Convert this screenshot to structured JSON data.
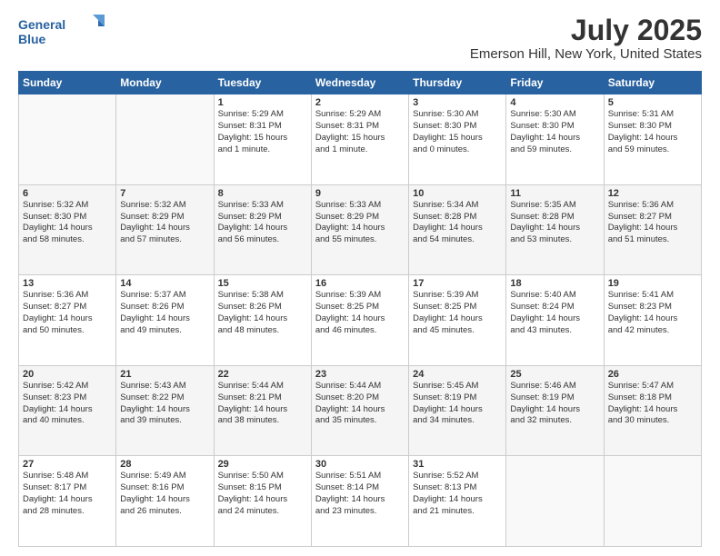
{
  "logo": {
    "line1": "General",
    "line2": "Blue"
  },
  "title": "July 2025",
  "subtitle": "Emerson Hill, New York, United States",
  "header_days": [
    "Sunday",
    "Monday",
    "Tuesday",
    "Wednesday",
    "Thursday",
    "Friday",
    "Saturday"
  ],
  "weeks": [
    [
      {
        "day": "",
        "info": ""
      },
      {
        "day": "",
        "info": ""
      },
      {
        "day": "1",
        "info": "Sunrise: 5:29 AM\nSunset: 8:31 PM\nDaylight: 15 hours\nand 1 minute."
      },
      {
        "day": "2",
        "info": "Sunrise: 5:29 AM\nSunset: 8:31 PM\nDaylight: 15 hours\nand 1 minute."
      },
      {
        "day": "3",
        "info": "Sunrise: 5:30 AM\nSunset: 8:30 PM\nDaylight: 15 hours\nand 0 minutes."
      },
      {
        "day": "4",
        "info": "Sunrise: 5:30 AM\nSunset: 8:30 PM\nDaylight: 14 hours\nand 59 minutes."
      },
      {
        "day": "5",
        "info": "Sunrise: 5:31 AM\nSunset: 8:30 PM\nDaylight: 14 hours\nand 59 minutes."
      }
    ],
    [
      {
        "day": "6",
        "info": "Sunrise: 5:32 AM\nSunset: 8:30 PM\nDaylight: 14 hours\nand 58 minutes."
      },
      {
        "day": "7",
        "info": "Sunrise: 5:32 AM\nSunset: 8:29 PM\nDaylight: 14 hours\nand 57 minutes."
      },
      {
        "day": "8",
        "info": "Sunrise: 5:33 AM\nSunset: 8:29 PM\nDaylight: 14 hours\nand 56 minutes."
      },
      {
        "day": "9",
        "info": "Sunrise: 5:33 AM\nSunset: 8:29 PM\nDaylight: 14 hours\nand 55 minutes."
      },
      {
        "day": "10",
        "info": "Sunrise: 5:34 AM\nSunset: 8:28 PM\nDaylight: 14 hours\nand 54 minutes."
      },
      {
        "day": "11",
        "info": "Sunrise: 5:35 AM\nSunset: 8:28 PM\nDaylight: 14 hours\nand 53 minutes."
      },
      {
        "day": "12",
        "info": "Sunrise: 5:36 AM\nSunset: 8:27 PM\nDaylight: 14 hours\nand 51 minutes."
      }
    ],
    [
      {
        "day": "13",
        "info": "Sunrise: 5:36 AM\nSunset: 8:27 PM\nDaylight: 14 hours\nand 50 minutes."
      },
      {
        "day": "14",
        "info": "Sunrise: 5:37 AM\nSunset: 8:26 PM\nDaylight: 14 hours\nand 49 minutes."
      },
      {
        "day": "15",
        "info": "Sunrise: 5:38 AM\nSunset: 8:26 PM\nDaylight: 14 hours\nand 48 minutes."
      },
      {
        "day": "16",
        "info": "Sunrise: 5:39 AM\nSunset: 8:25 PM\nDaylight: 14 hours\nand 46 minutes."
      },
      {
        "day": "17",
        "info": "Sunrise: 5:39 AM\nSunset: 8:25 PM\nDaylight: 14 hours\nand 45 minutes."
      },
      {
        "day": "18",
        "info": "Sunrise: 5:40 AM\nSunset: 8:24 PM\nDaylight: 14 hours\nand 43 minutes."
      },
      {
        "day": "19",
        "info": "Sunrise: 5:41 AM\nSunset: 8:23 PM\nDaylight: 14 hours\nand 42 minutes."
      }
    ],
    [
      {
        "day": "20",
        "info": "Sunrise: 5:42 AM\nSunset: 8:23 PM\nDaylight: 14 hours\nand 40 minutes."
      },
      {
        "day": "21",
        "info": "Sunrise: 5:43 AM\nSunset: 8:22 PM\nDaylight: 14 hours\nand 39 minutes."
      },
      {
        "day": "22",
        "info": "Sunrise: 5:44 AM\nSunset: 8:21 PM\nDaylight: 14 hours\nand 38 minutes."
      },
      {
        "day": "23",
        "info": "Sunrise: 5:44 AM\nSunset: 8:20 PM\nDaylight: 14 hours\nand 35 minutes."
      },
      {
        "day": "24",
        "info": "Sunrise: 5:45 AM\nSunset: 8:19 PM\nDaylight: 14 hours\nand 34 minutes."
      },
      {
        "day": "25",
        "info": "Sunrise: 5:46 AM\nSunset: 8:19 PM\nDaylight: 14 hours\nand 32 minutes."
      },
      {
        "day": "26",
        "info": "Sunrise: 5:47 AM\nSunset: 8:18 PM\nDaylight: 14 hours\nand 30 minutes."
      }
    ],
    [
      {
        "day": "27",
        "info": "Sunrise: 5:48 AM\nSunset: 8:17 PM\nDaylight: 14 hours\nand 28 minutes."
      },
      {
        "day": "28",
        "info": "Sunrise: 5:49 AM\nSunset: 8:16 PM\nDaylight: 14 hours\nand 26 minutes."
      },
      {
        "day": "29",
        "info": "Sunrise: 5:50 AM\nSunset: 8:15 PM\nDaylight: 14 hours\nand 24 minutes."
      },
      {
        "day": "30",
        "info": "Sunrise: 5:51 AM\nSunset: 8:14 PM\nDaylight: 14 hours\nand 23 minutes."
      },
      {
        "day": "31",
        "info": "Sunrise: 5:52 AM\nSunset: 8:13 PM\nDaylight: 14 hours\nand 21 minutes."
      },
      {
        "day": "",
        "info": ""
      },
      {
        "day": "",
        "info": ""
      }
    ]
  ]
}
